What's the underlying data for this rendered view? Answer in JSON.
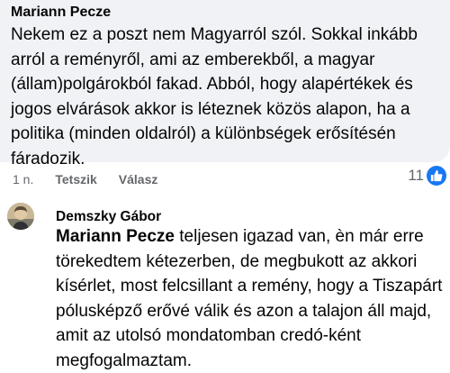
{
  "comment1": {
    "author": "Mariann Pecze",
    "lines": [
      "Nekem ez a poszt nem Magyarról szól. Sokkal inkább",
      "arról a reményről, ami az emberekből, a magyar",
      "(állam)polgárokból fakad. Abból, hogy alapértékek és",
      "jogos elvárások akkor is léteznek közös alapon, ha a",
      "politika (minden oldalról) a különbségek erősítésén",
      "fáradozik."
    ],
    "time": "1 n.",
    "like_label": "Tetszik",
    "reply_label": "Válasz",
    "reaction_count": "11",
    "reaction_icon": "like-icon",
    "bubble_color": "#f0f2f5",
    "reaction_color": "#1877f2"
  },
  "comment2": {
    "author": "Demszky Gábor",
    "mention": "Mariann Pecze",
    "first_line_rest": " teljesen igazad van, èn már erre",
    "lines": [
      "törekedtem kétezerben, de megbukott az akkori",
      "kísérlet, most felcsillant a remény, hogy a Tiszapárt",
      "pólusképző erővé válik és azon a talajon áll majd,",
      "amit az utolsó mondatomban credó-ként",
      "megfogalmaztam."
    ]
  }
}
